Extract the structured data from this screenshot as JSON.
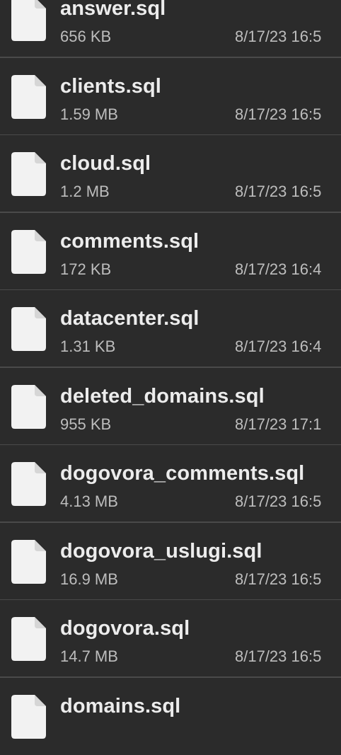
{
  "files": [
    {
      "name": "answer.sql",
      "size": "656 KB",
      "date": "8/17/23 16:5"
    },
    {
      "name": "clients.sql",
      "size": "1.59 MB",
      "date": "8/17/23 16:5"
    },
    {
      "name": "cloud.sql",
      "size": "1.2 MB",
      "date": "8/17/23 16:5"
    },
    {
      "name": "comments.sql",
      "size": "172 KB",
      "date": "8/17/23 16:4"
    },
    {
      "name": "datacenter.sql",
      "size": "1.31 KB",
      "date": "8/17/23 16:4"
    },
    {
      "name": "deleted_domains.sql",
      "size": "955 KB",
      "date": "8/17/23 17:1"
    },
    {
      "name": "dogovora_comments.sql",
      "size": "4.13 MB",
      "date": "8/17/23 16:5"
    },
    {
      "name": "dogovora_uslugi.sql",
      "size": "16.9 MB",
      "date": "8/17/23 16:5"
    },
    {
      "name": "dogovora.sql",
      "size": "14.7 MB",
      "date": "8/17/23 16:5"
    },
    {
      "name": "domains.sql",
      "size": "",
      "date": ""
    }
  ],
  "colors": {
    "background": "#2b2b2b",
    "divider": "#4a4a4a",
    "name_text": "#ececec",
    "meta_text": "#bdbdbd",
    "icon_fill": "#f2f2f2"
  },
  "icon": "file-document-icon"
}
